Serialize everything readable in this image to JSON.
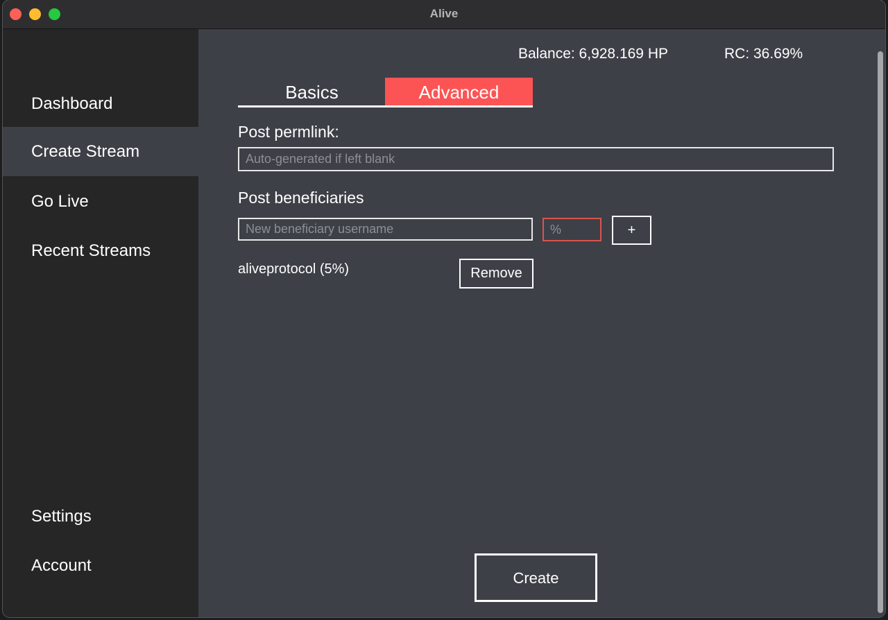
{
  "window": {
    "title": "Alive"
  },
  "sidebar": {
    "items": [
      {
        "label": "Dashboard",
        "active": false
      },
      {
        "label": "Create Stream",
        "active": true
      },
      {
        "label": "Go Live",
        "active": false
      },
      {
        "label": "Recent Streams",
        "active": false
      },
      {
        "label": "Settings",
        "active": false
      },
      {
        "label": "Account",
        "active": false
      }
    ]
  },
  "header": {
    "balance": "Balance: 6,928.169 HP",
    "rc": "RC: 36.69%"
  },
  "tabs": [
    {
      "label": "Basics",
      "active": false
    },
    {
      "label": "Advanced",
      "active": true
    }
  ],
  "form": {
    "permlink_label": "Post permlink:",
    "permlink_placeholder": "Auto-generated if left blank",
    "permlink_value": "",
    "beneficiaries_label": "Post beneficiaries",
    "beneficiary_user_placeholder": "New beneficiary username",
    "beneficiary_pct_placeholder": "%",
    "add_label": "+",
    "beneficiaries": [
      {
        "text": "aliveprotocol (5%)",
        "remove_label": "Remove"
      }
    ],
    "create_label": "Create"
  },
  "colors": {
    "accent": "#fc5454",
    "sidebar_bg": "#262626",
    "main_bg": "#3e4048",
    "error_border": "#d9544f"
  }
}
